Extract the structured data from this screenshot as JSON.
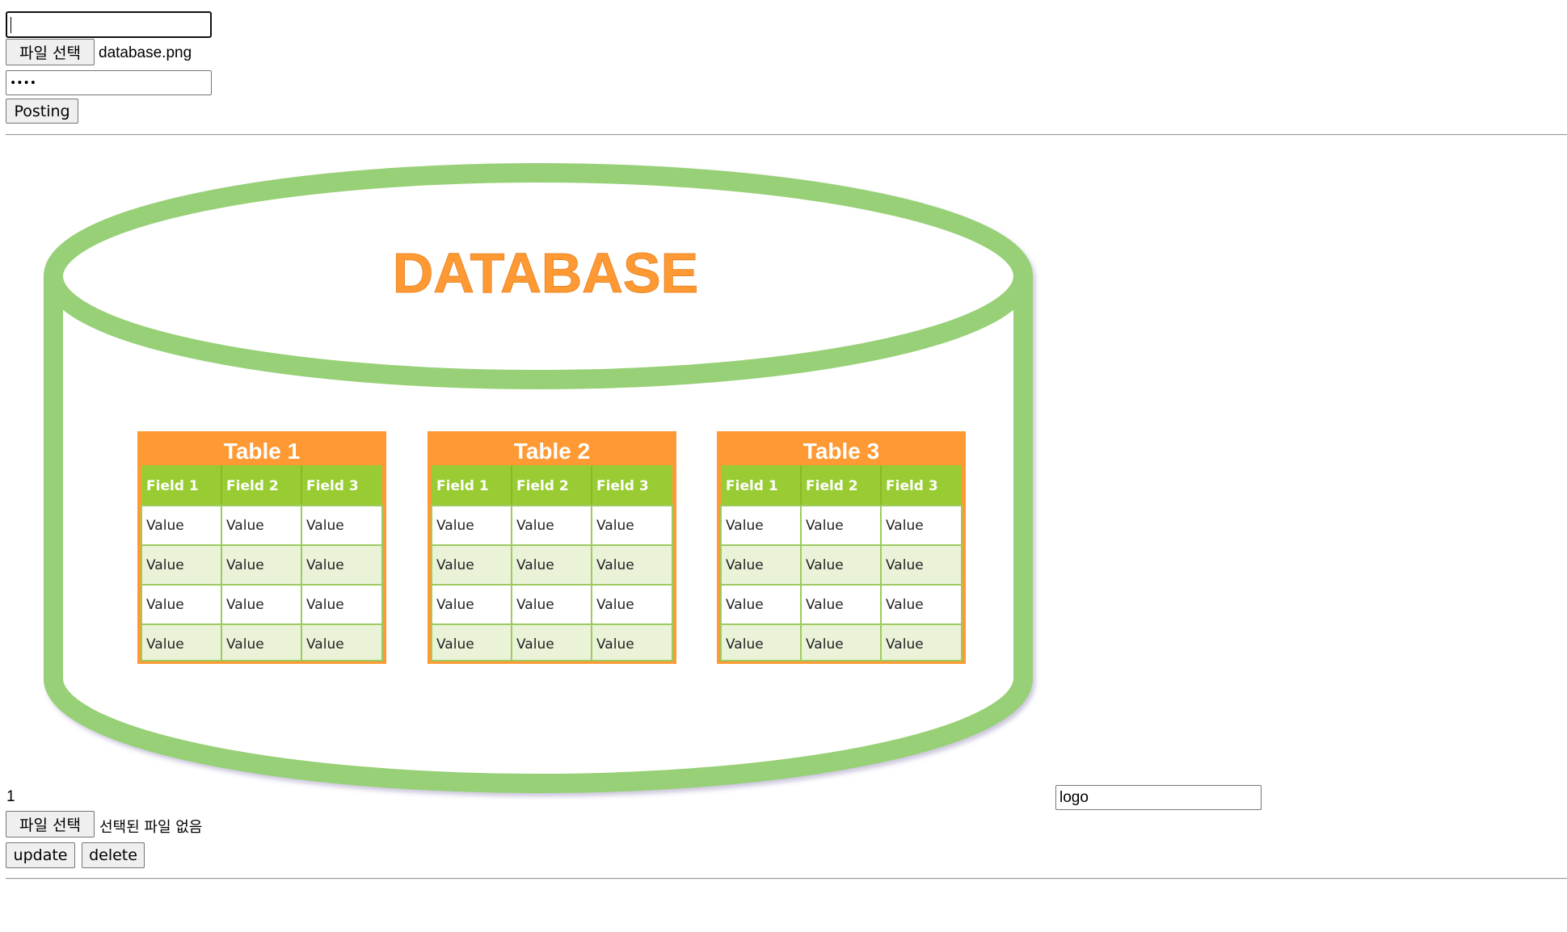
{
  "post_form": {
    "title_input": {
      "value": "",
      "placeholder": ""
    },
    "file_button_label": "파일 선택",
    "file_name": "database.png",
    "password_mask": "••••",
    "submit_label": "Posting"
  },
  "post": {
    "id": "1",
    "file_button_label": "파일 선택",
    "no_file_text": "선택된 파일 없음",
    "title_input_value": "logo",
    "update_label": "update",
    "delete_label": "delete"
  },
  "image": {
    "heading": "DATABASE",
    "tables": [
      {
        "title": "Table 1",
        "fields": [
          "Field 1",
          "Field 2",
          "Field 3"
        ],
        "rows": [
          [
            "Value",
            "Value",
            "Value"
          ],
          [
            "Value",
            "Value",
            "Value"
          ],
          [
            "Value",
            "Value",
            "Value"
          ],
          [
            "Value",
            "Value",
            "Value"
          ]
        ]
      },
      {
        "title": "Table 2",
        "fields": [
          "Field 1",
          "Field 2",
          "Field 3"
        ],
        "rows": [
          [
            "Value",
            "Value",
            "Value"
          ],
          [
            "Value",
            "Value",
            "Value"
          ],
          [
            "Value",
            "Value",
            "Value"
          ],
          [
            "Value",
            "Value",
            "Value"
          ]
        ]
      },
      {
        "title": "Table 3",
        "fields": [
          "Field 1",
          "Field 2",
          "Field 3"
        ],
        "rows": [
          [
            "Value",
            "Value",
            "Value"
          ],
          [
            "Value",
            "Value",
            "Value"
          ],
          [
            "Value",
            "Value",
            "Value"
          ],
          [
            "Value",
            "Value",
            "Value"
          ]
        ]
      }
    ],
    "colors": {
      "cylinder": "#97d076",
      "heading": "#ff9933",
      "table_title_bg": "#ff9933",
      "field_header_bg": "#99cc33",
      "row_alt_bg": "#eaf2d8",
      "cell_border": "#9ccb5e"
    }
  }
}
